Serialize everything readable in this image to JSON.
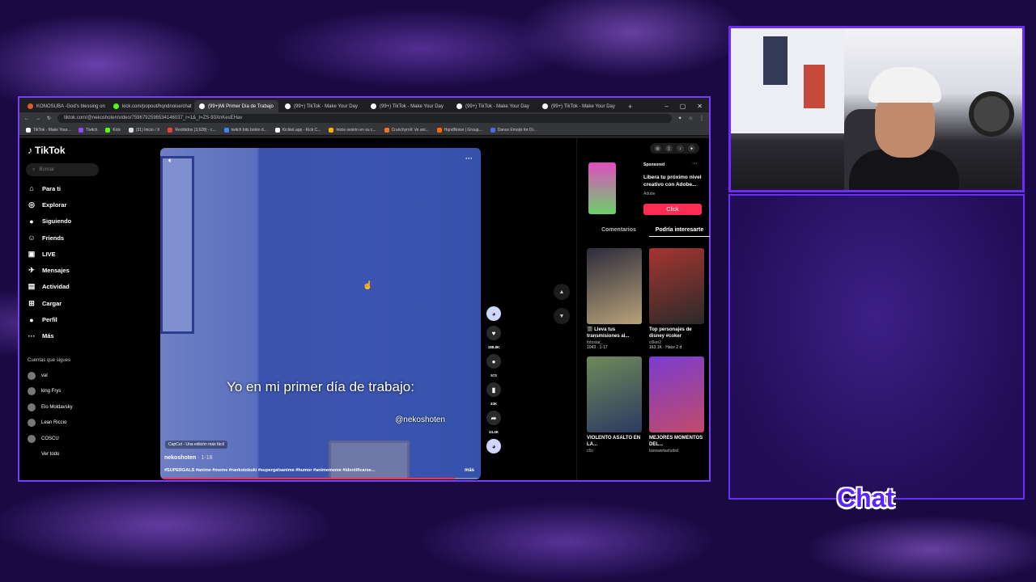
{
  "browser": {
    "tabs": [
      {
        "label": "KONOSUBA -God's blessing on",
        "color": "#e05a2a"
      },
      {
        "label": "kick.com/popout/hqndnoise/chat",
        "color": "#53fc18"
      },
      {
        "label": "(99+)Mi Primer Día de Trabajo",
        "color": "#ffffff",
        "active": true
      },
      {
        "label": "(99+) TikTok - Make Your Day",
        "color": "#ffffff"
      },
      {
        "label": "(99+) TikTok - Make Your Day",
        "color": "#ffffff"
      },
      {
        "label": "(99+) TikTok - Make Your Day",
        "color": "#ffffff"
      },
      {
        "label": "(99+) TikTok - Make Your Day",
        "color": "#ffffff"
      }
    ],
    "new_tab": "+",
    "window_controls": [
      "–",
      "▢",
      "✕"
    ],
    "url": "tiktok.com/@nekoshoten/video/7596792596534146037_r=1&_t=ZS-93XnKesEHav",
    "bookmarks": [
      {
        "label": "TikTok - Make Your...",
        "color": "#ffffff"
      },
      {
        "label": "Twitch",
        "color": "#9146ff"
      },
      {
        "label": "Kick",
        "color": "#53fc18"
      },
      {
        "label": "(31) Inicio / X",
        "color": "#dddddd"
      },
      {
        "label": "Recibidos (3,628) - c...",
        "color": "#ea4335"
      },
      {
        "label": "twitch bits botón d...",
        "color": "#4285f4"
      },
      {
        "label": "Kicklet.app - Kick C...",
        "color": "#ffffff"
      },
      {
        "label": "Inicie sesión en su c...",
        "color": "#f4b400"
      },
      {
        "label": "Crunchyroll: Ve ani...",
        "color": "#f47521"
      },
      {
        "label": "HqndNoise | Group...",
        "color": "#ff6a00"
      },
      {
        "label": "Dance Emojis for Di...",
        "color": "#5865f2"
      }
    ]
  },
  "tiktok": {
    "logo": "TikTok",
    "search_placeholder": "Buscar",
    "nav": [
      {
        "label": "Para ti",
        "icon": "home-icon",
        "glyph": "⌂"
      },
      {
        "label": "Explorar",
        "icon": "compass-icon",
        "glyph": "◎"
      },
      {
        "label": "Siguiendo",
        "icon": "following-avatar-icon",
        "glyph": "●"
      },
      {
        "label": "Friends",
        "icon": "friends-icon",
        "glyph": "☺"
      },
      {
        "label": "LIVE",
        "icon": "live-icon",
        "glyph": "▣"
      },
      {
        "label": "Mensajes",
        "icon": "message-icon",
        "glyph": "✈",
        "badge": "99"
      },
      {
        "label": "Actividad",
        "icon": "activity-icon",
        "glyph": "▤",
        "badge": "99+"
      },
      {
        "label": "Cargar",
        "icon": "upload-icon",
        "glyph": "⊞"
      },
      {
        "label": "Perfil",
        "icon": "profile-avatar-icon",
        "glyph": "●"
      },
      {
        "label": "Más",
        "icon": "more-icon",
        "glyph": "···"
      }
    ],
    "following_title": "Cuentas que sigues",
    "following": [
      {
        "name": "val"
      },
      {
        "name": "king Frys"
      },
      {
        "name": "Elo Moldavsky"
      },
      {
        "name": "Lean Riccio"
      },
      {
        "name": "COSCU"
      },
      {
        "name": "Ver todo"
      }
    ],
    "video": {
      "caption": "Yo en mi primer día de trabajo:",
      "watermark": "@nekoshoten",
      "capcut": "CapCut - Una edición más fácil",
      "author": "nekoshoten",
      "date": " · 1-18",
      "tags": "#SUPERGALS #anime #meme #rankotobuki #supergalsanime #humor #animememe #identificarse...",
      "more": "más",
      "progress": 0.92
    },
    "actions": {
      "likes": "188.8K",
      "comments": "573",
      "saves": "33K",
      "shares": "34.4K"
    },
    "ad": {
      "sponsored": "Sponsored",
      "title": "Libera tu próximo nivel creativo con Adobe...",
      "brand": "Adobe",
      "button": "Click"
    },
    "right_tabs": [
      "Comentarios",
      "Podría interesarte"
    ],
    "cards": [
      {
        "title": "🎬 Lleva tus transmisiones al...",
        "author": "fotostar_",
        "stats": "1043 · 1-17",
        "thumb": "linear-gradient(160deg,#2b2b3a,#b9a27a)"
      },
      {
        "title": "Top personajes de disney #coker",
        "author": "c0ker2",
        "stats": "163.1K · Hace 2 d",
        "thumb": "linear-gradient(160deg,#a6352f,#2a2a2a)"
      },
      {
        "title": "VIOLENTO ASALTO EN LA...",
        "author": "c5n",
        "stats": "",
        "thumb": "linear-gradient(160deg,#6f8a5a,#2a3a60)"
      },
      {
        "title": "MEJORES MOMENTOS DEL...",
        "author": "laswawitasfutbol",
        "stats": "",
        "thumb": "linear-gradient(160deg,#7a3cd0,#c24a6a)"
      }
    ]
  },
  "overlay": {
    "chat_label": "Chat"
  }
}
